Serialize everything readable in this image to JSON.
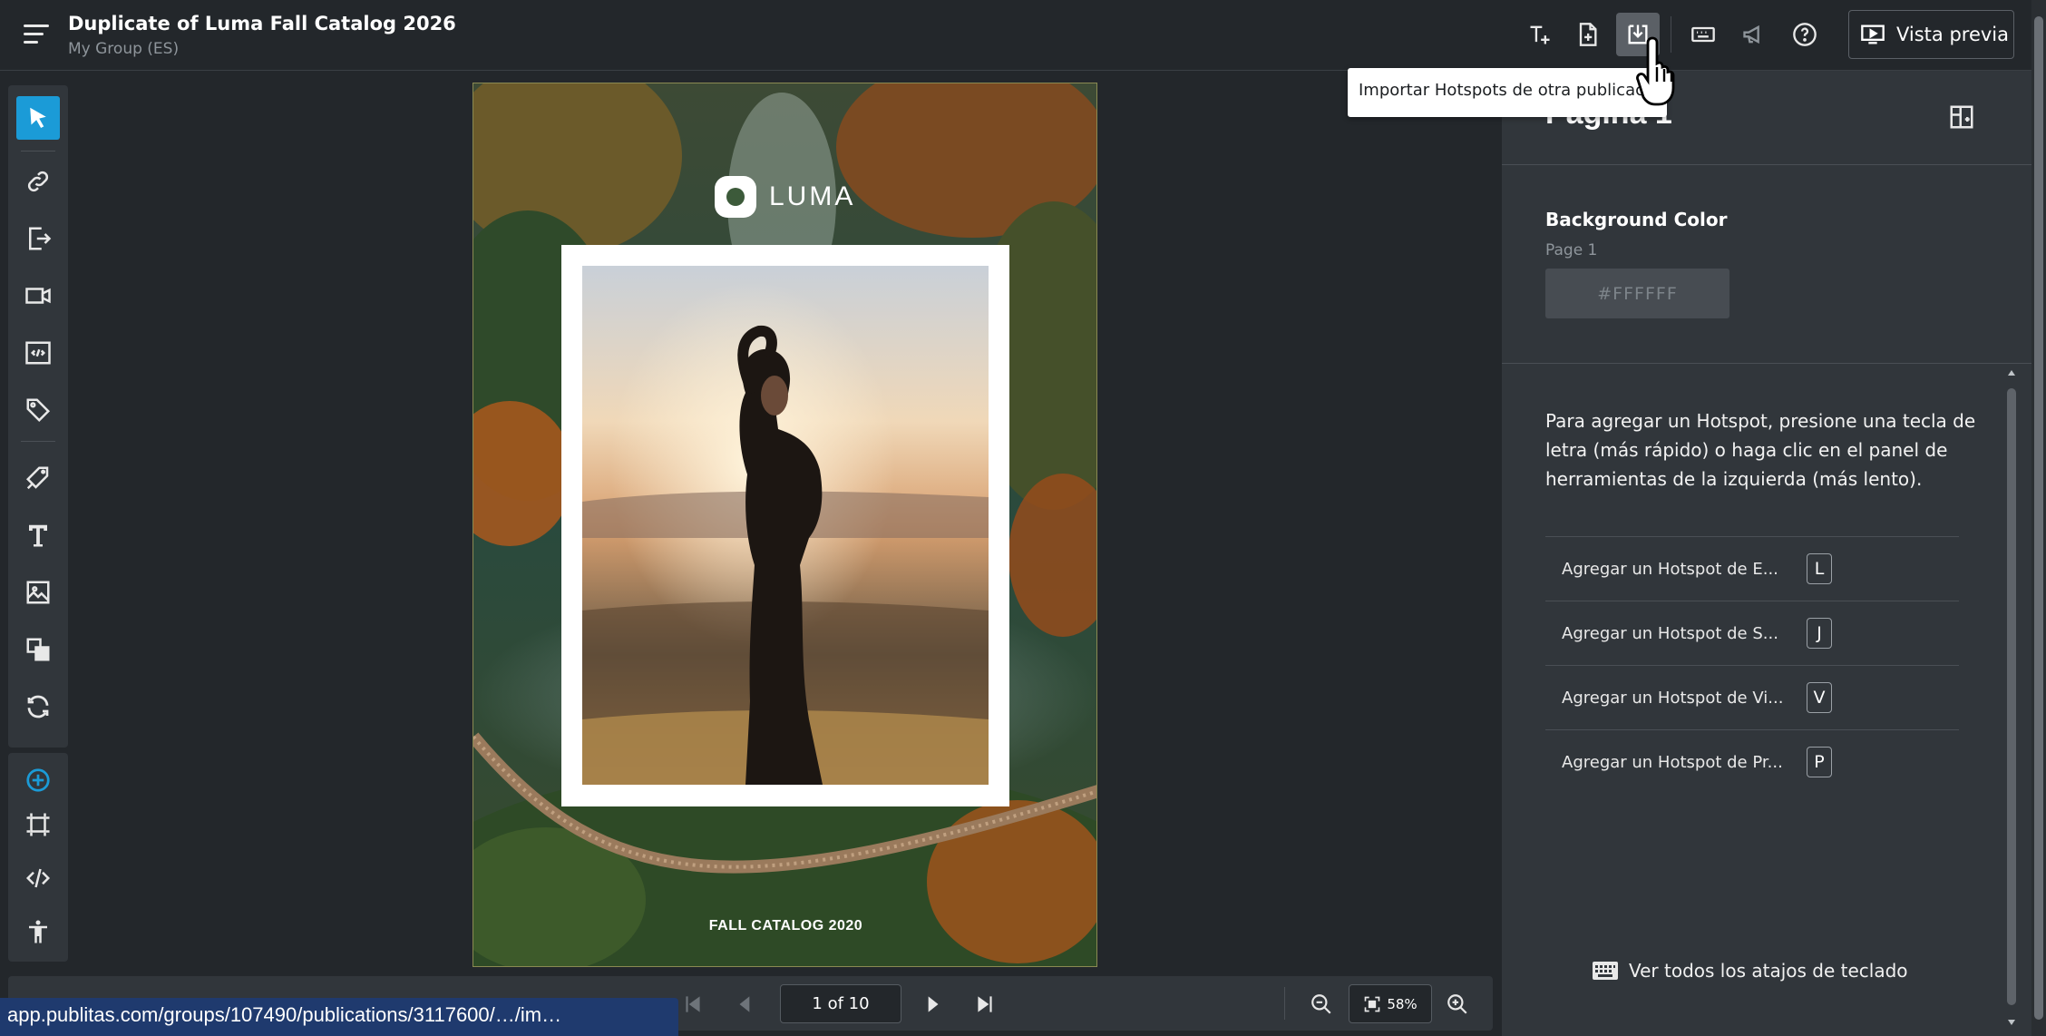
{
  "header": {
    "title": "Duplicate of Luma Fall Catalog 2026",
    "subtitle": "My Group (ES)",
    "preview_label": "Vista previa",
    "icons": [
      "add-text-icon",
      "add-page-icon",
      "import-hotspots-icon",
      "keyboard-icon",
      "announcement-icon",
      "help-icon",
      "preview-icon"
    ]
  },
  "tooltip": {
    "text": "Importar Hotspots de otra publicación"
  },
  "left_toolbar": {
    "tools": [
      "select-tool-icon",
      "link-tool-icon",
      "page-link-tool-icon",
      "video-tool-icon",
      "embed-tool-icon",
      "product-tag-tool-icon",
      "style-tool-icon",
      "text-tool-icon",
      "image-tool-icon",
      "layers-tool-icon",
      "refresh-tool-icon"
    ],
    "secondary": [
      "add-circle-icon",
      "frame-icon",
      "code-icon",
      "accessibility-icon"
    ]
  },
  "page": {
    "logo_text": "LUMA",
    "catalog_label": "FALL CATALOG 2020"
  },
  "bottom_bar": {
    "page_indicator": "1 of 10",
    "zoom": "58%"
  },
  "status_url": "app.publitas.com/groups/107490/publications/3117600/…/im…",
  "right_panel": {
    "title": "Pagina 1",
    "background_color_label": "Background Color",
    "background_color_sub": "Page 1",
    "background_color_value": "#FFFFFF",
    "help_text": "Para agregar un Hotspot, presione una tecla de letra (más rápido) o haga clic en el panel de herramientas de la izquierda (más lento).",
    "hotspots": [
      {
        "label": "Agregar un Hotspot de E...",
        "key": "L"
      },
      {
        "label": "Agregar un Hotspot de S...",
        "key": "J"
      },
      {
        "label": "Agregar un Hotspot de Vi...",
        "key": "V"
      },
      {
        "label": "Agregar un Hotspot de Pr...",
        "key": "P"
      }
    ],
    "shortcuts_label": "Ver todos los atajos de teclado"
  },
  "colors": {
    "accent": "#1b9bd7",
    "background": "#23272b",
    "panel": "#31363b"
  }
}
